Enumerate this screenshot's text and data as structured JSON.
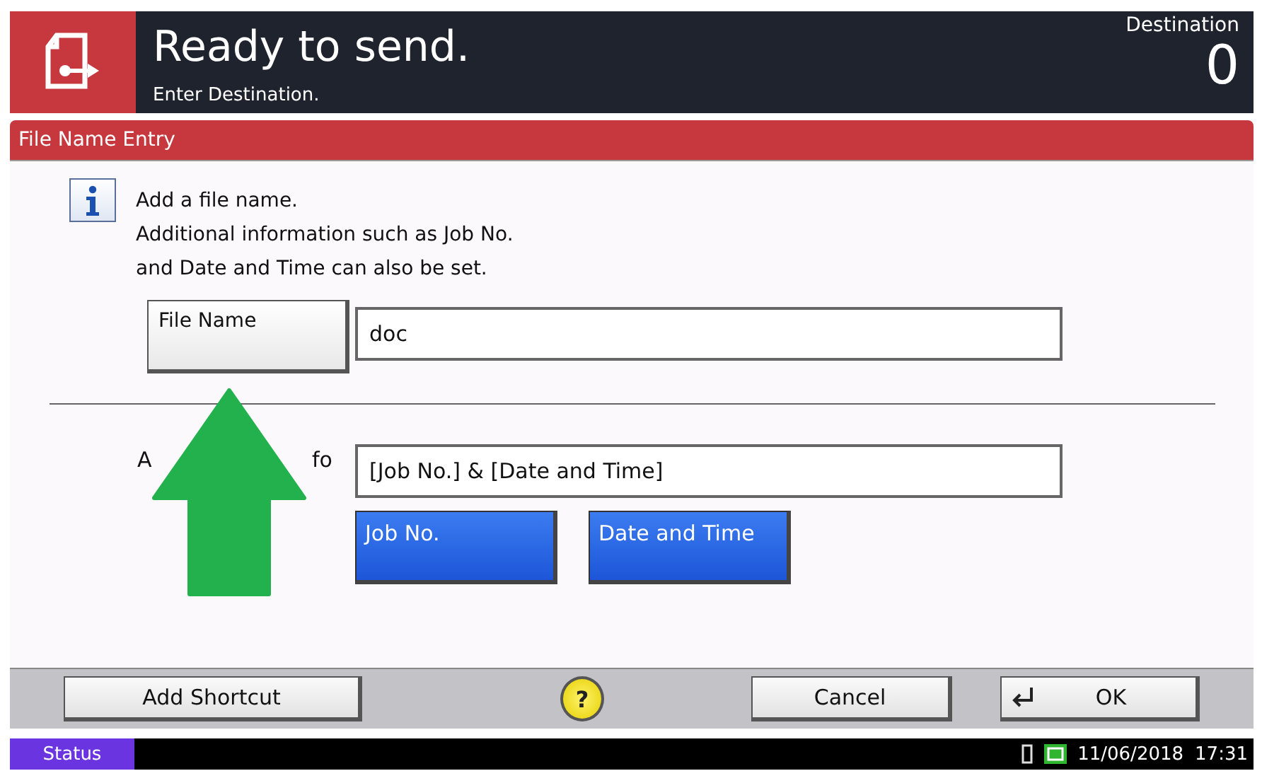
{
  "header": {
    "title": "Ready to send.",
    "subtitle": "Enter Destination.",
    "destination_label": "Destination",
    "destination_count": "0"
  },
  "panel": {
    "title": "File Name Entry"
  },
  "info": {
    "lines": [
      "Add a file name.",
      "Additional information such as Job No.",
      "and Date and Time can also be set."
    ]
  },
  "file_name": {
    "button": "File Name",
    "value": "doc"
  },
  "additional_info": {
    "label_parts": [
      "A",
      "fo"
    ],
    "value": "[Job No.] & [Date and Time]",
    "buttons": [
      {
        "label": "Job No.",
        "selected": true
      },
      {
        "label": "Date and Time",
        "selected": true
      }
    ]
  },
  "footer": {
    "buttons": [
      {
        "kind": "plain",
        "label": "Add Shortcut"
      },
      {
        "kind": "help",
        "label": "?"
      },
      {
        "kind": "plain",
        "label": "Cancel"
      },
      {
        "kind": "enter",
        "label": "OK"
      }
    ]
  },
  "status_bar": {
    "status": "Status",
    "date": "11/06/2018",
    "time": "17:31"
  }
}
